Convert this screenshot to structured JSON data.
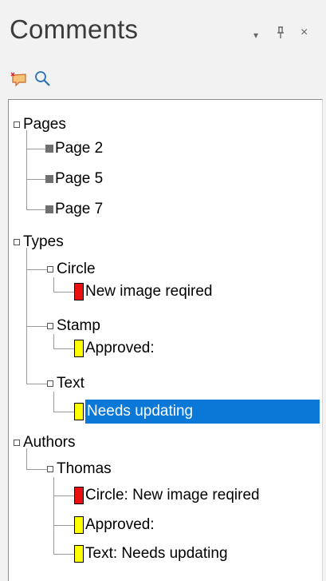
{
  "panel": {
    "title": "Comments",
    "controls": {
      "menu": "▾",
      "pin": "ᵖ",
      "close": "×"
    }
  },
  "toolbar": {
    "icons": [
      "new-comment-icon",
      "search-icon"
    ]
  },
  "colors": {
    "selection": "#0a78d7",
    "red": "#e81010",
    "yellow": "#ffff00"
  },
  "tree": {
    "pages": {
      "label": "Pages",
      "items": [
        "Page 2",
        "Page 5",
        "Page 7"
      ]
    },
    "types": {
      "label": "Types",
      "circle": {
        "label": "Circle",
        "item": "New image reqired"
      },
      "stamp": {
        "label": "Stamp",
        "item": "Approved:"
      },
      "text": {
        "label": "Text",
        "item": "Needs updating"
      }
    },
    "authors": {
      "label": "Authors",
      "thomas": {
        "label": "Thomas",
        "items": [
          "Circle: New image reqired",
          "Approved:",
          "Text: Needs updating"
        ]
      }
    }
  }
}
